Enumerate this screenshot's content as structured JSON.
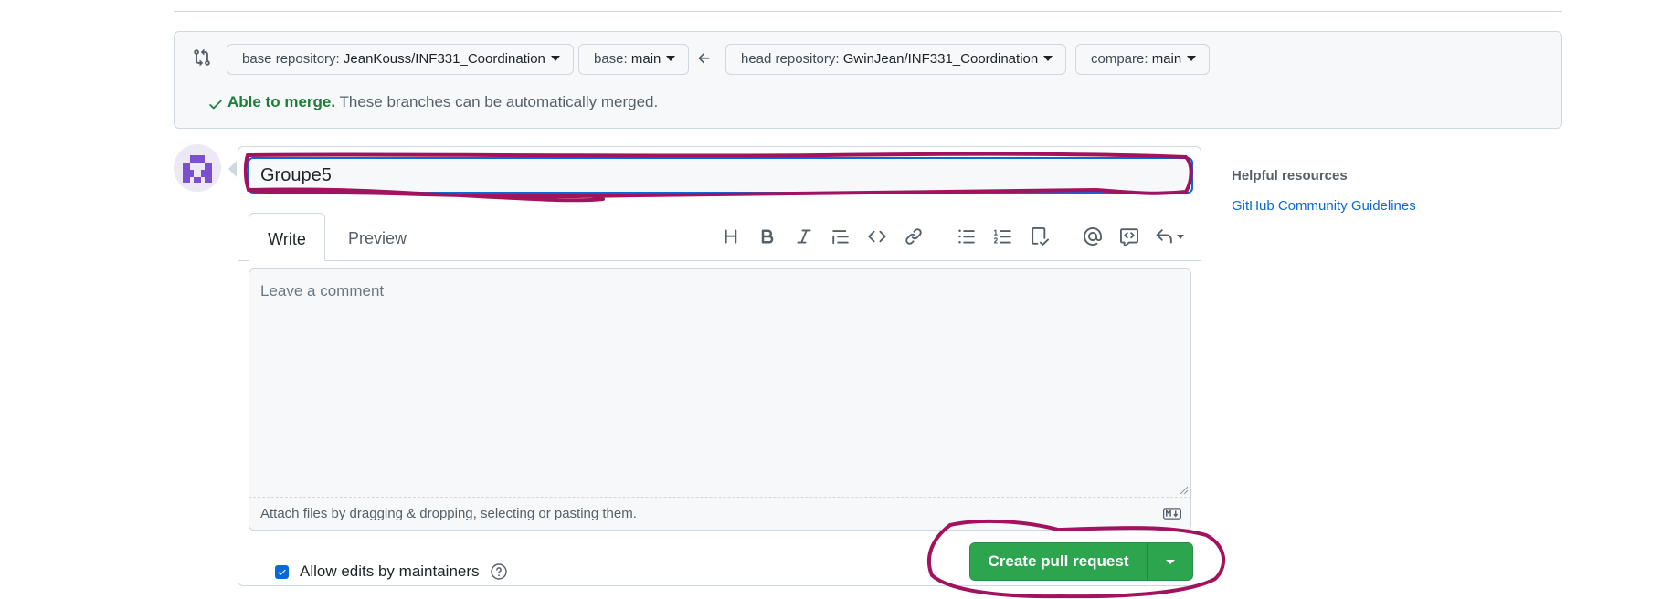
{
  "compare": {
    "base_repo_label": "base repository:",
    "base_repo_value": "JeanKouss/INF331_Coordination",
    "base_label": "base:",
    "base_value": "main",
    "head_repo_label": "head repository:",
    "head_repo_value": "GwinJean/INF331_Coordination",
    "compare_label": "compare:",
    "compare_value": "main",
    "merge_status_strong": "Able to merge.",
    "merge_status_rest": " These branches can be automatically merged."
  },
  "editor": {
    "title_value": "Groupe5",
    "tabs": [
      {
        "label": "Write"
      },
      {
        "label": "Preview"
      }
    ],
    "toolbar_icons": [
      "heading-icon",
      "bold-icon",
      "italic-icon",
      "quote-icon",
      "code-icon",
      "link-icon",
      "unordered-list-icon",
      "ordered-list-icon",
      "task-list-icon",
      "mention-icon",
      "reference-icon",
      "undo-icon"
    ],
    "comment_placeholder": "Leave a comment",
    "attach_hint": "Attach files by dragging & dropping, selecting or pasting them.",
    "allow_edits_label": "Allow edits by maintainers",
    "allow_edits_checked": true,
    "create_button_label": "Create pull request"
  },
  "sidebar": {
    "heading": "Helpful resources",
    "link": "GitHub Community Guidelines"
  },
  "colors": {
    "primary_button": "#2da44e",
    "link": "#0969da",
    "success": "#1a7f37",
    "annotation": "#a3125e"
  }
}
